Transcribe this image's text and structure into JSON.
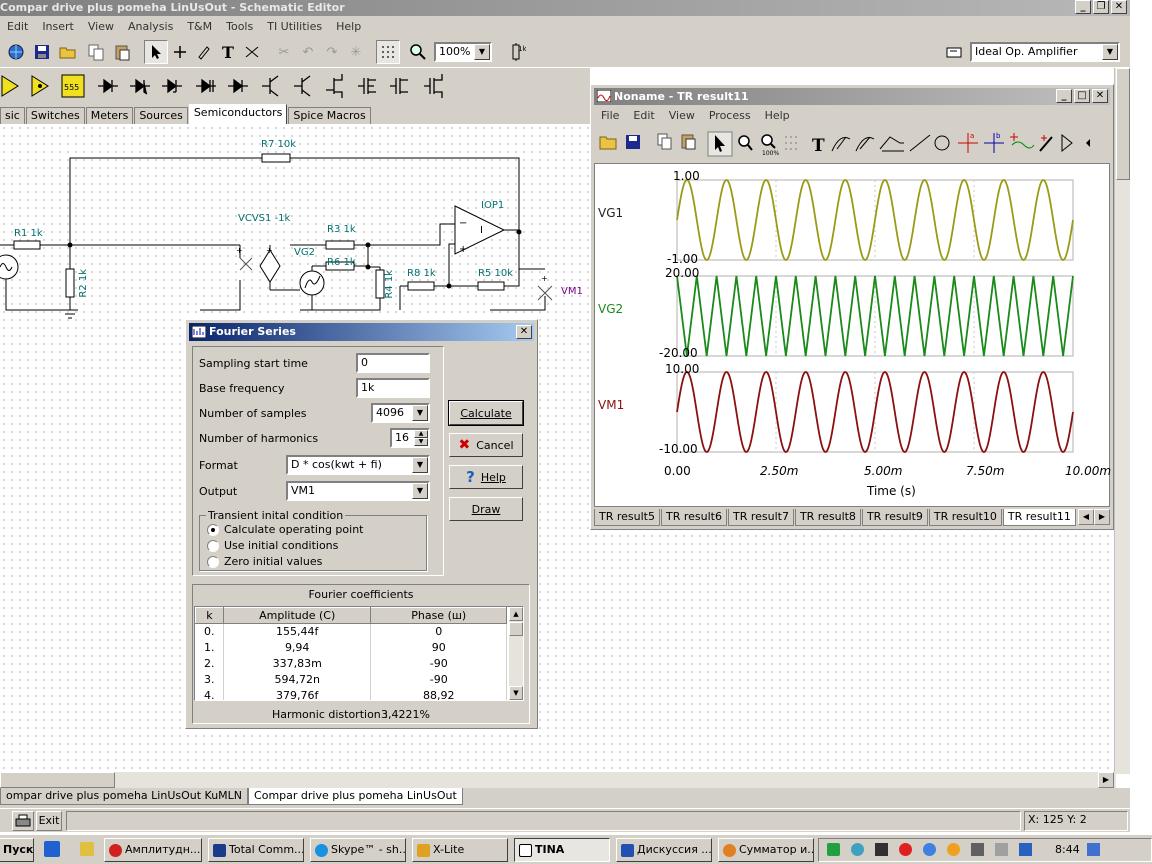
{
  "main_window": {
    "title": "Compar drive plus  pomeha LinUsOut - Schematic Editor",
    "menu": [
      "Edit",
      "Insert",
      "View",
      "Analysis",
      "T&M",
      "Tools",
      "TI Utilities",
      "Help"
    ],
    "zoom": "100%",
    "component_select": "Ideal Op. Amplifier",
    "component_tabs": [
      "sic",
      "Switches",
      "Meters",
      "Sources",
      "Semiconductors",
      "Spice Macros"
    ],
    "active_component_tab": "Semiconductors"
  },
  "schematic": {
    "labels": {
      "r7": "R7 10k",
      "r1": "R1 1k",
      "r2": "R2 1k",
      "vcvs": "VCVS1 -1k",
      "r3": "R3 1k",
      "vg2": "VG2",
      "r6": "R6 1k",
      "r4": "R4 1k",
      "r8": "R8 1k",
      "r5": "R5 10k",
      "iop": "IOP1",
      "vm1": "VM1"
    }
  },
  "grapher": {
    "title": "Noname - TR result11",
    "menu": [
      "File",
      "Edit",
      "View",
      "Process",
      "Help"
    ],
    "signals": [
      {
        "name": "VG1",
        "ymax": "1.00",
        "ymin": "-1.00",
        "color": "#9a9a18"
      },
      {
        "name": "VG2",
        "ymax": "20.00",
        "ymin": "-20.00",
        "color": "#1a8a1a"
      },
      {
        "name": "VM1",
        "ymax": "10.00",
        "ymin": "-10.00",
        "color": "#8b1010"
      }
    ],
    "x_ticks": [
      "0.00",
      "2.50m",
      "5.00m",
      "7.50m",
      "10.00m"
    ],
    "x_label": "Time (s)",
    "tabs": [
      "TR result5",
      "TR result6",
      "TR result7",
      "TR result8",
      "TR result9",
      "TR result10",
      "TR result11"
    ],
    "active_tab": "TR result11"
  },
  "fourier": {
    "title": "Fourier Series",
    "fields": {
      "sampling_start_label": "Sampling start time",
      "sampling_start_value": "0",
      "base_freq_label": "Base frequency",
      "base_freq_value": "1k",
      "samples_label": "Number of samples",
      "samples_value": "4096",
      "harmonics_label": "Number of harmonics",
      "harmonics_value": "16",
      "format_label": "Format",
      "format_value": "D * cos(kwt + fi)",
      "output_label": "Output",
      "output_value": "VM1"
    },
    "buttons": {
      "calculate": "Calculate",
      "cancel": "Cancel",
      "help": "Help",
      "draw": "Draw"
    },
    "transient_group": "Transient inital condition",
    "transient_options": [
      "Calculate operating point",
      "Use initial conditions",
      "Zero initial values"
    ],
    "selected_option": 0,
    "coef_title": "Fourier coefficients",
    "coef_headers": [
      "k",
      "Amplitude (C)",
      "Phase (ш)"
    ],
    "coef_rows": [
      [
        "0.",
        "155,44f",
        "0"
      ],
      [
        "1.",
        "9,94",
        "90"
      ],
      [
        "2.",
        "337,83m",
        "-90"
      ],
      [
        "3.",
        "594,72n",
        "-90"
      ],
      [
        "4.",
        "379,76f",
        "88,92"
      ]
    ],
    "distortion_label": "Harmonic distortion :",
    "distortion_value": "3,4221%"
  },
  "sheet_tabs": [
    "ompar drive plus  pomeha LinUsOut KuMLN",
    "Compar drive plus  pomeha LinUsOut"
  ],
  "active_sheet": "Compar drive plus  pomeha LinUsOut",
  "status": {
    "exit_label": "Exit",
    "coords": "X: 125 Y: 2"
  },
  "taskbar": {
    "start": "Пуск",
    "tasks": [
      "Амплитудн...",
      "Total Comm...",
      "Skype™ - sh...",
      "X-Lite",
      "TINA",
      "Дискуссия ...",
      "Сумматор и..."
    ],
    "active_task": "TINA",
    "clock": "8:44"
  }
}
